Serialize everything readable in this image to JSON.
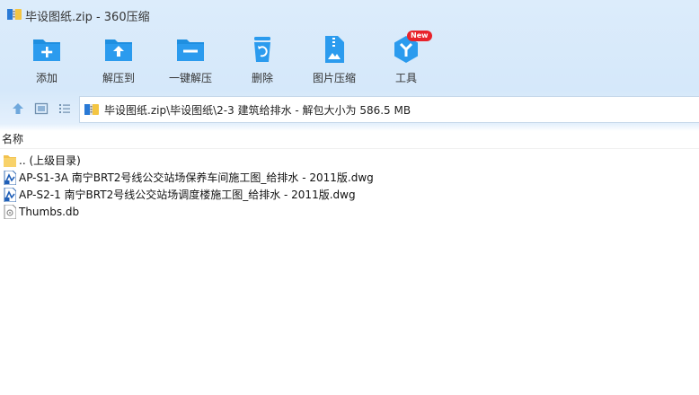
{
  "window": {
    "title": "毕设图纸.zip - 360压缩"
  },
  "toolbar": {
    "items": [
      {
        "label": "添加",
        "icon": "add-icon"
      },
      {
        "label": "解压到",
        "icon": "extract-to-icon"
      },
      {
        "label": "一键解压",
        "icon": "one-click-extract-icon"
      },
      {
        "label": "删除",
        "icon": "delete-icon"
      },
      {
        "label": "图片压缩",
        "icon": "image-compress-icon"
      },
      {
        "label": "工具",
        "icon": "tools-icon",
        "badge": "New"
      }
    ]
  },
  "nav": {
    "address": "毕设图纸.zip\\毕设图纸\\2-3 建筑给排水 - 解包大小为 586.5 MB"
  },
  "list": {
    "column_name": "名称",
    "items": [
      {
        "name": ".. (上级目录)",
        "icon": "folder-icon"
      },
      {
        "name": "AP-S1-3A 南宁BRT2号线公交站场保养车间施工图_给排水 - 2011版.dwg",
        "icon": "dwg-file-icon"
      },
      {
        "name": "AP-S2-1 南宁BRT2号线公交站场调度楼施工图_给排水 - 2011版.dwg",
        "icon": "dwg-file-icon"
      },
      {
        "name": "Thumbs.db",
        "icon": "db-file-icon"
      }
    ]
  },
  "colors": {
    "toolbar_bg": "#d5e8fa",
    "icon_blue": "#1f8fe0",
    "badge_red": "#e8232b"
  }
}
